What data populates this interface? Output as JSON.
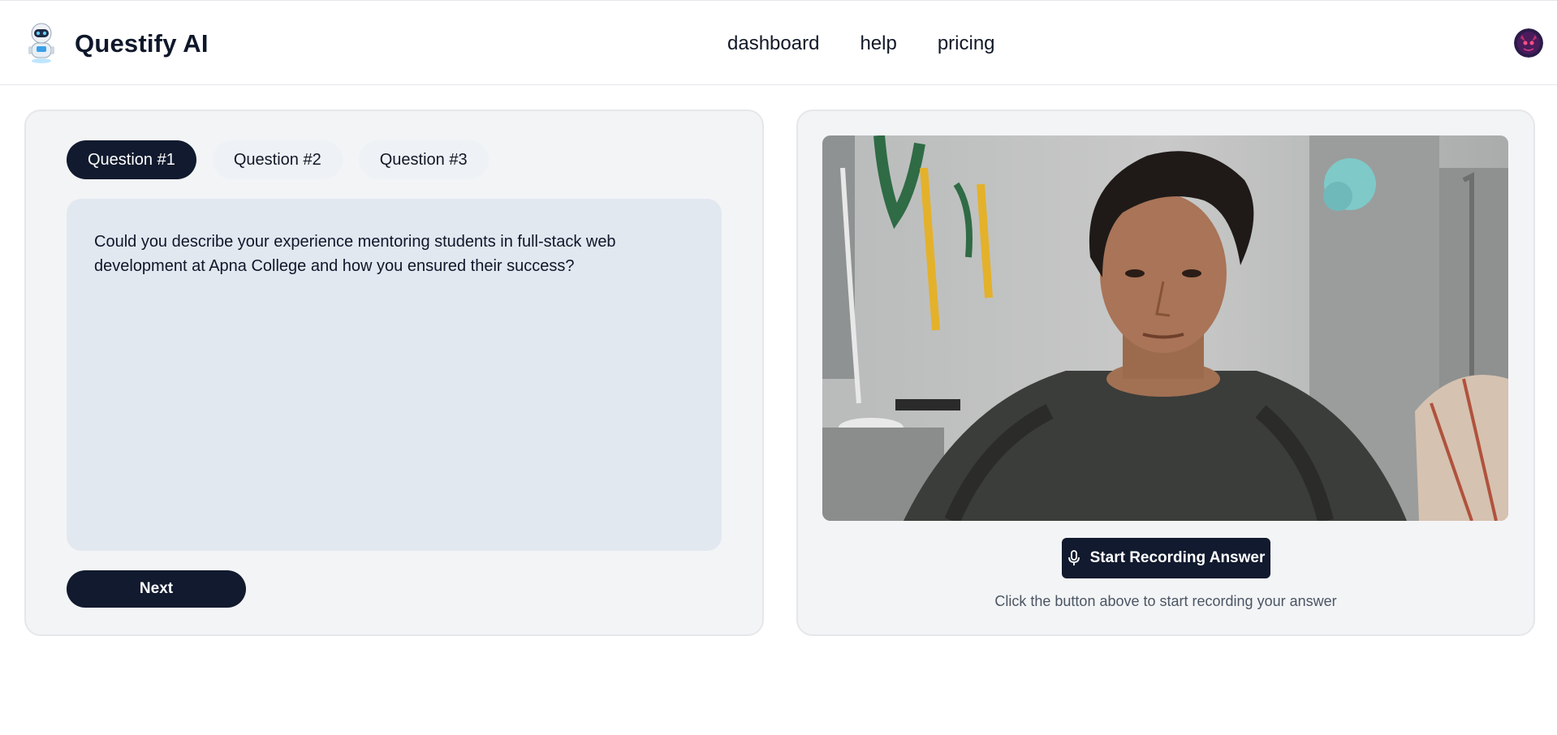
{
  "header": {
    "brand": "Questify AI",
    "logo_icon": "robot-mascot-icon",
    "nav": [
      "dashboard",
      "help",
      "pricing"
    ],
    "avatar_icon": "user-avatar"
  },
  "interview": {
    "tabs": [
      "Question #1",
      "Question #2",
      "Question #3"
    ],
    "active_tab": 0,
    "question": "Could you describe your experience mentoring students in full-stack web development at Apna College and how you ensured their success?",
    "next_label": "Next"
  },
  "recorder": {
    "video_feed": "webcam-preview",
    "record_label": "Start Recording Answer",
    "record_icon": "microphone-icon",
    "hint": "Click the button above to start recording your answer"
  },
  "colors": {
    "primary": "#111a2e",
    "panel_bg": "#f3f4f6",
    "question_bg": "#e2e8f0"
  }
}
